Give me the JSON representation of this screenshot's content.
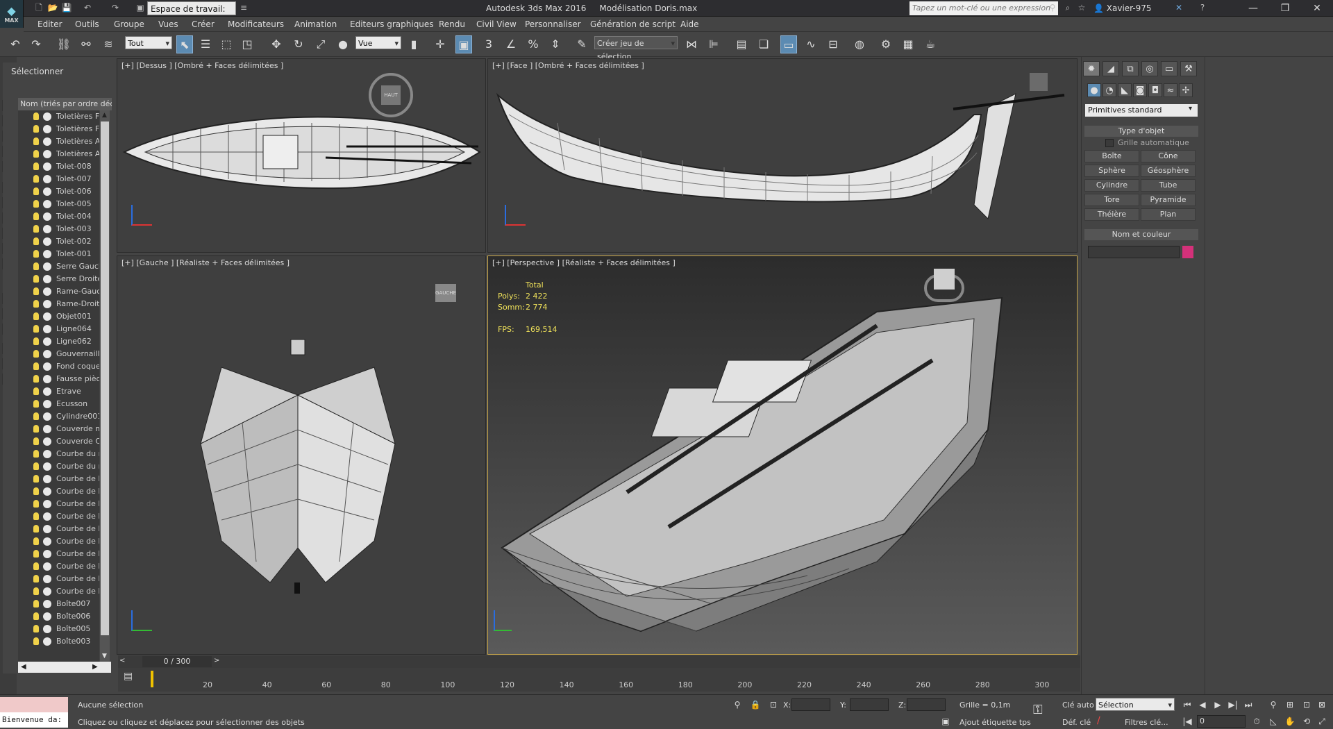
{
  "app": {
    "logo_text": "MAX",
    "workspace": "Espace de travail: Par",
    "title": "Autodesk 3ds Max 2016     Modélisation Doris.max",
    "search_placeholder": "Tapez un mot-clé ou une expression",
    "user": "Xavier-975"
  },
  "menu": [
    "Editer",
    "Outils",
    "Groupe",
    "Vues",
    "Créer",
    "Modificateurs",
    "Animation",
    "Editeurs graphiques",
    "Rendu",
    "Civil View",
    "Personnaliser",
    "Génération de script",
    "Aide"
  ],
  "toolbar": {
    "selection_filter": "Tout",
    "ref_coord": "Vue",
    "named_sel": "Créer jeu de sélection",
    "snap_labels": [
      "3",
      "",
      "%",
      "",
      ""
    ]
  },
  "explorer": {
    "title": "Sélectionner",
    "column_header": "Nom (triés par ordre décroissant)",
    "objects": [
      "Toletières Fc",
      "Toletières FD",
      "Toletières AC",
      "Toletières AD",
      "Tolet-008",
      "Tolet-007",
      "Tolet-006",
      "Tolet-005",
      "Tolet-004",
      "Tolet-003",
      "Tolet-002",
      "Tolet-001",
      "Serre Gauche",
      "Serre Droite",
      "Rame-Gauche",
      "Rame-Droite",
      "Objet001",
      "Ligne064",
      "Ligne062",
      "Gouvernaille",
      "Fond coque",
      "Fausse pièce",
      "Etrave",
      "Ecusson",
      "Cylindre001",
      "Couverde m",
      "Couverde C",
      "Courbe du m",
      "Courbe du m",
      "Courbe de l'é",
      "Courbe de l'é",
      "Courbe de l'é",
      "Courbe de l'é",
      "Courbe de l'é",
      "Courbe de l'é",
      "Courbe de l'é",
      "Courbe de l'é",
      "Courbe de l'é",
      "Courbe de l'é",
      "Boîte007",
      "Boîte006",
      "Boîte005",
      "Boîte003"
    ]
  },
  "viewports": {
    "top": {
      "label": "[+] [Dessus ] [Ombré + Faces délimitées ]",
      "cube": "HAUT"
    },
    "front": {
      "label": "[+] [Face ] [Ombré + Faces délimitées ]"
    },
    "left": {
      "label": "[+] [Gauche ] [Réaliste + Faces délimitées ]",
      "cube": "GAUCHE"
    },
    "persp": {
      "label": "[+] [Perspective ] [Réaliste + Faces délimitées ]"
    }
  },
  "stats": {
    "header": "Total",
    "polys_label": "Polys:",
    "polys": "2 422",
    "verts_label": "Somm:",
    "verts": "2 774",
    "fps_label": "FPS:",
    "fps": "169,514"
  },
  "command_panel": {
    "category": "Primitives standard",
    "object_type_title": "Type d'objet",
    "autogrid": "Grille automatique",
    "buttons": [
      "Boîte",
      "Cône",
      "Sphère",
      "Géosphère",
      "Cylindre",
      "Tube",
      "Tore",
      "Pyramide",
      "Théière",
      "Plan"
    ],
    "name_color_title": "Nom et couleur",
    "object_color": "#d4317a"
  },
  "timeline": {
    "slider": "0 / 300",
    "ticks": [
      "20",
      "40",
      "60",
      "80",
      "100",
      "120",
      "140",
      "160",
      "180",
      "200",
      "220",
      "240",
      "260",
      "280",
      "300"
    ]
  },
  "status": {
    "selection": "Aucune sélection",
    "prompt": "Cliquez ou cliquez et déplacez pour sélectionner des objets",
    "listener": "Bienvenue da:",
    "x_label": "X:",
    "y_label": "Y:",
    "z_label": "Z:",
    "grid": "Grille = 0,1m",
    "add_tag": "Ajout étiquette tps",
    "auto_key": "Clé auto",
    "set_key": "Déf. clé",
    "key_mode": "Sélection",
    "key_filters": "Filtres clé...",
    "frame": "0"
  },
  "colors": {
    "accent": "#5c8bb2",
    "persp_border": "#c9a74a",
    "stats": "#f0e25a"
  }
}
